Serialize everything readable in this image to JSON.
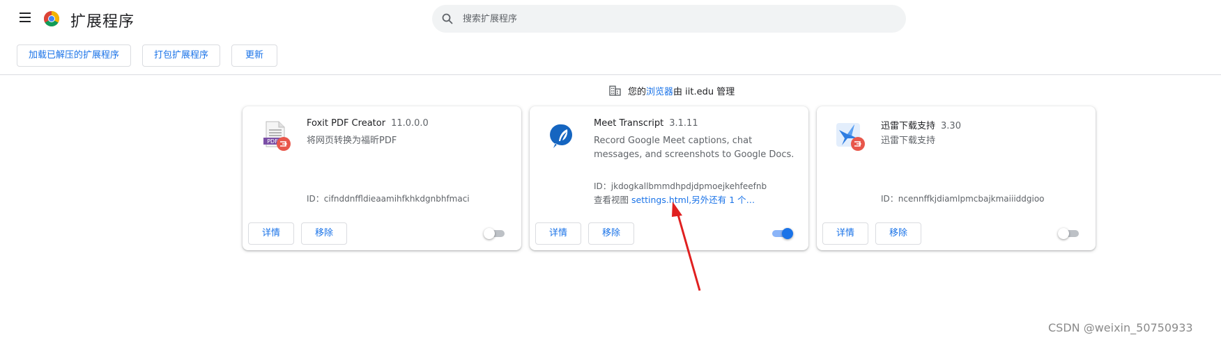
{
  "header": {
    "title": "扩展程序",
    "search_placeholder": "搜索扩展程序"
  },
  "toolbar": {
    "load_unpacked": "加载已解压的扩展程序",
    "pack": "打包扩展程序",
    "update": "更新"
  },
  "managed": {
    "prefix": "您的",
    "link": "浏览器",
    "suffix": "由 iit.edu 管理"
  },
  "extensions": [
    {
      "name": "Foxit PDF Creator",
      "version": "11.0.0.0",
      "description": "将网页转换为福昕PDF",
      "id": "ID：cifnddnffldieaamihfkhkdgnbhfmaci",
      "details_label": "详情",
      "remove_label": "移除",
      "enabled": false,
      "icon": "pdf-document-icon"
    },
    {
      "name": "Meet Transcript",
      "version": "3.1.11",
      "description": "Record Google Meet captions, chat messages, and screenshots to Google Docs.",
      "id": "ID：jkdogkallbmmdhpdjdpmoejkehfeefnb",
      "views_prefix": "查看视图",
      "views_link": "settings.html",
      "views_more": ",另外还有 1 个…",
      "details_label": "详情",
      "remove_label": "移除",
      "enabled": true,
      "icon": "quill-bubble-icon"
    },
    {
      "name": "迅雷下载支持",
      "version": "3.30",
      "description": "迅雷下载支持",
      "id": "ID：ncennffkjdiamlpmcbajkmaiiiddgioo",
      "details_label": "详情",
      "remove_label": "移除",
      "enabled": false,
      "icon": "thunder-bird-icon"
    }
  ],
  "watermark": "CSDN @weixin_50750933",
  "colors": {
    "accent": "#1a73e8",
    "text": "#202124",
    "secondary_text": "#5f6368",
    "annotation_arrow": "#e02020"
  }
}
